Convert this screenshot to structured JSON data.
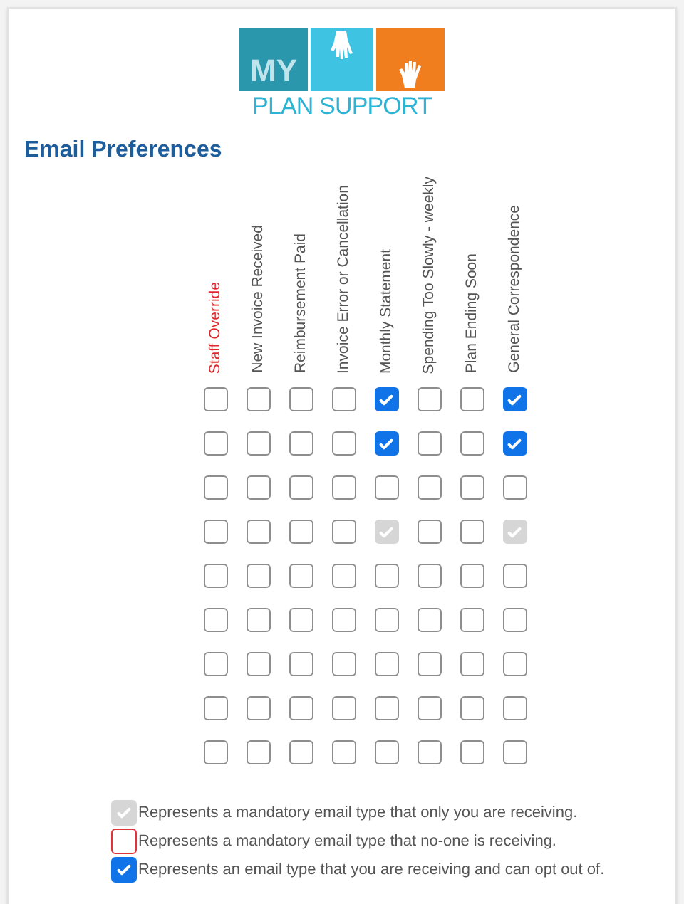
{
  "logo": {
    "top": "MY",
    "bottom": "PLAN SUPPORT"
  },
  "heading": "Email Preferences",
  "columns": [
    {
      "label": "Staff Override",
      "kind": "warning"
    },
    {
      "label": "New Invoice Received",
      "kind": "normal"
    },
    {
      "label": "Reimbursement Paid",
      "kind": "normal"
    },
    {
      "label": "Invoice Error or Cancellation",
      "kind": "normal"
    },
    {
      "label": "Monthly Statement",
      "kind": "normal"
    },
    {
      "label": "Spending Too Slowly - weekly",
      "kind": "normal"
    },
    {
      "label": "Plan Ending Soon",
      "kind": "normal"
    },
    {
      "label": "General Correspondence",
      "kind": "normal"
    }
  ],
  "rows": [
    [
      {
        "checked": false,
        "disabled": false
      },
      {
        "checked": false,
        "disabled": false
      },
      {
        "checked": false,
        "disabled": false
      },
      {
        "checked": false,
        "disabled": false
      },
      {
        "checked": true,
        "disabled": false
      },
      {
        "checked": false,
        "disabled": false
      },
      {
        "checked": false,
        "disabled": false
      },
      {
        "checked": true,
        "disabled": false
      }
    ],
    [
      {
        "checked": false,
        "disabled": false
      },
      {
        "checked": false,
        "disabled": false
      },
      {
        "checked": false,
        "disabled": false
      },
      {
        "checked": false,
        "disabled": false
      },
      {
        "checked": true,
        "disabled": false
      },
      {
        "checked": false,
        "disabled": false
      },
      {
        "checked": false,
        "disabled": false
      },
      {
        "checked": true,
        "disabled": false
      }
    ],
    [
      {
        "checked": false,
        "disabled": false
      },
      {
        "checked": false,
        "disabled": false
      },
      {
        "checked": false,
        "disabled": false
      },
      {
        "checked": false,
        "disabled": false
      },
      {
        "checked": false,
        "disabled": false
      },
      {
        "checked": false,
        "disabled": false
      },
      {
        "checked": false,
        "disabled": false
      },
      {
        "checked": false,
        "disabled": false
      }
    ],
    [
      {
        "checked": false,
        "disabled": false
      },
      {
        "checked": false,
        "disabled": false
      },
      {
        "checked": false,
        "disabled": false
      },
      {
        "checked": false,
        "disabled": false
      },
      {
        "checked": true,
        "disabled": true
      },
      {
        "checked": false,
        "disabled": false
      },
      {
        "checked": false,
        "disabled": false
      },
      {
        "checked": true,
        "disabled": true
      }
    ],
    [
      {
        "checked": false,
        "disabled": false
      },
      {
        "checked": false,
        "disabled": false
      },
      {
        "checked": false,
        "disabled": false
      },
      {
        "checked": false,
        "disabled": false
      },
      {
        "checked": false,
        "disabled": false
      },
      {
        "checked": false,
        "disabled": false
      },
      {
        "checked": false,
        "disabled": false
      },
      {
        "checked": false,
        "disabled": false
      }
    ],
    [
      {
        "checked": false,
        "disabled": false
      },
      {
        "checked": false,
        "disabled": false
      },
      {
        "checked": false,
        "disabled": false
      },
      {
        "checked": false,
        "disabled": false
      },
      {
        "checked": false,
        "disabled": false
      },
      {
        "checked": false,
        "disabled": false
      },
      {
        "checked": false,
        "disabled": false
      },
      {
        "checked": false,
        "disabled": false
      }
    ],
    [
      {
        "checked": false,
        "disabled": false
      },
      {
        "checked": false,
        "disabled": false
      },
      {
        "checked": false,
        "disabled": false
      },
      {
        "checked": false,
        "disabled": false
      },
      {
        "checked": false,
        "disabled": false
      },
      {
        "checked": false,
        "disabled": false
      },
      {
        "checked": false,
        "disabled": false
      },
      {
        "checked": false,
        "disabled": false
      }
    ],
    [
      {
        "checked": false,
        "disabled": false
      },
      {
        "checked": false,
        "disabled": false
      },
      {
        "checked": false,
        "disabled": false
      },
      {
        "checked": false,
        "disabled": false
      },
      {
        "checked": false,
        "disabled": false
      },
      {
        "checked": false,
        "disabled": false
      },
      {
        "checked": false,
        "disabled": false
      },
      {
        "checked": false,
        "disabled": false
      }
    ],
    [
      {
        "checked": false,
        "disabled": false
      },
      {
        "checked": false,
        "disabled": false
      },
      {
        "checked": false,
        "disabled": false
      },
      {
        "checked": false,
        "disabled": false
      },
      {
        "checked": false,
        "disabled": false
      },
      {
        "checked": false,
        "disabled": false
      },
      {
        "checked": false,
        "disabled": false
      },
      {
        "checked": false,
        "disabled": false
      }
    ]
  ],
  "legend": [
    {
      "text": "Represents a mandatory email type that only you are receiving.",
      "kind": "mandatory"
    },
    {
      "text": "Represents a mandatory email type that no-one is receiving.",
      "kind": "missing"
    },
    {
      "text": "Represents an email type that you are receiving and can opt out of.",
      "kind": "optional"
    }
  ]
}
